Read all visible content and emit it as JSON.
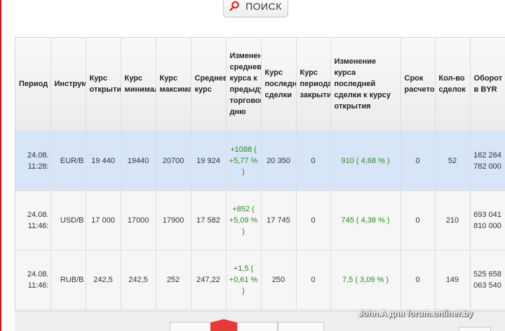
{
  "search": {
    "label": "ПОИСК"
  },
  "table": {
    "headers": [
      "Период",
      "Инструмент",
      "Курс открытия",
      "Курс минимальный",
      "Курс максимальный",
      "Средневзвешенный курс",
      "Изменение средневзвешенного курса к предыдущему торговому дню",
      "Курс последней сделки",
      "Курс периода закрытия",
      "Изменение курса последней сделки к курсу открытия",
      "Срок расчетов",
      "Кол-во сделок",
      "Оборот в BYR"
    ],
    "rows": [
      {
        "period": "24.08. 11:28:",
        "instrument": "EUR/B",
        "open": "19 440",
        "min": "19440",
        "max": "20700",
        "avg": "19 924",
        "avg_change": "+1088 ( +5,77 % )",
        "last": "20 350",
        "close": "0",
        "last_change": "910 ( 4,68 % )",
        "term": "0",
        "deals": "52",
        "turnover": "162 264 782 000"
      },
      {
        "period": "24.08. 11:46:",
        "instrument": "USD/B",
        "open": "17 000",
        "min": "17000",
        "max": "17900",
        "avg": "17 582",
        "avg_change": "+852 ( +5,09 % )",
        "last": "17 745",
        "close": "0",
        "last_change": "745 ( 4,38 % )",
        "term": "0",
        "deals": "210",
        "turnover": "693 041 810 000"
      },
      {
        "period": "24.08. 11:46:",
        "instrument": "RUB/B",
        "open": "242,5",
        "min": "242,5",
        "max": "252",
        "avg": "247,22",
        "avg_change": "+1,5 ( +0,61 % )",
        "last": "250",
        "close": "0",
        "last_change": "7,5 ( 3,09 % )",
        "term": "0",
        "deals": "149",
        "turnover": "525 658 063 540"
      }
    ]
  },
  "watermark": "John.A для forum.onliner.by",
  "colors": {
    "highlight_row": "#d8e5f8",
    "positive": "#2a8a1e",
    "accent": "#e43a3a"
  }
}
